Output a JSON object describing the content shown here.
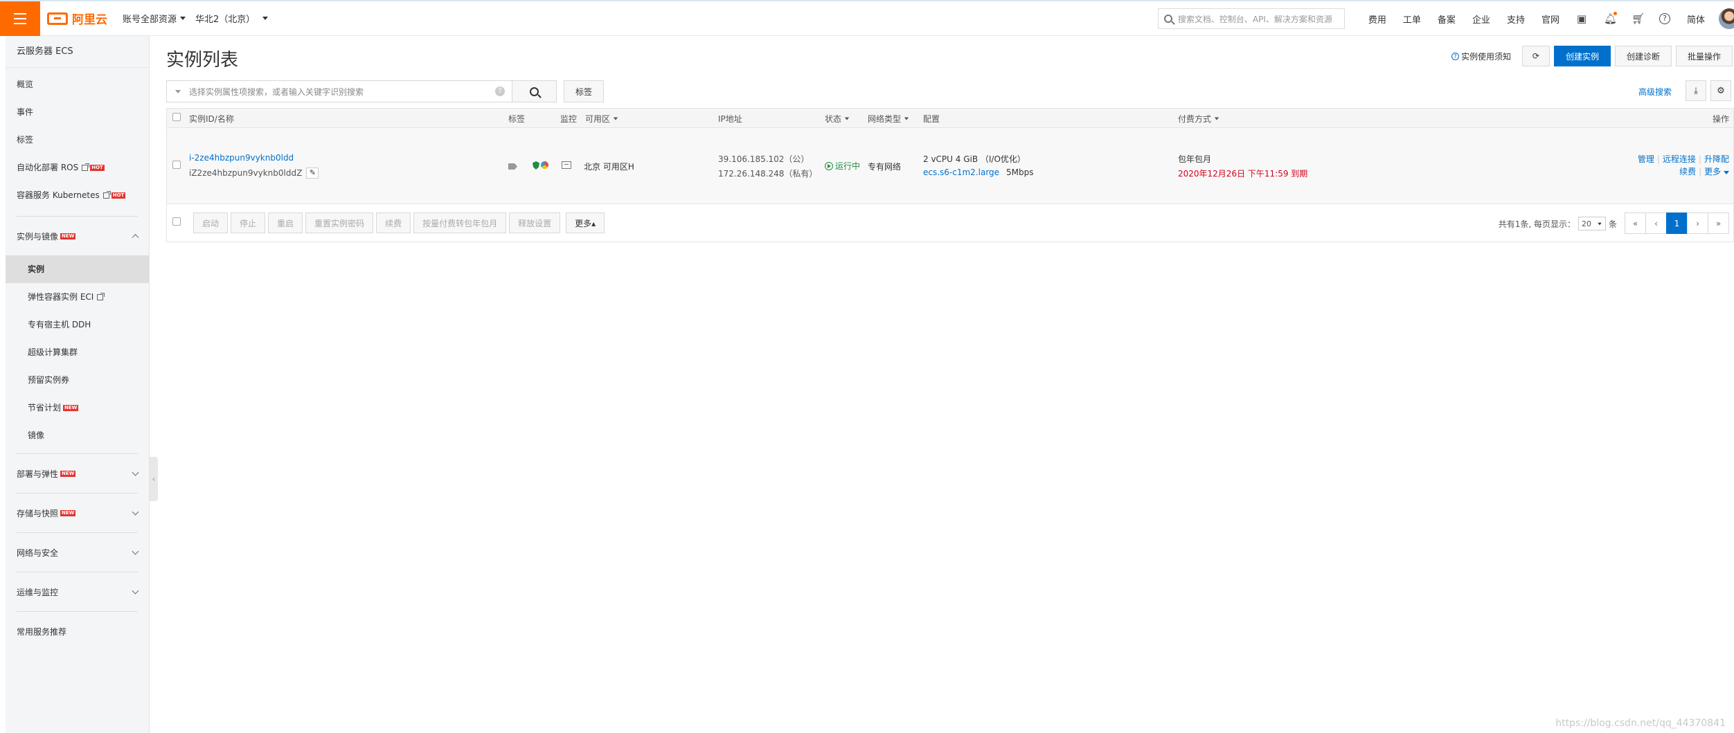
{
  "topbar": {
    "logo_text": "阿里云",
    "account_dropdown": "账号全部资源",
    "region_dropdown": "华北2（北京）",
    "search_placeholder": "搜索文档、控制台、API、解决方案和资源",
    "links": [
      "费用",
      "工单",
      "备案",
      "企业",
      "支持",
      "官网"
    ],
    "language": "简体",
    "icons": [
      "terminal-icon",
      "bell-icon",
      "cart-icon",
      "help-icon"
    ]
  },
  "sidebar": {
    "title": "云服务器 ECS",
    "top_items": [
      {
        "label": "概览"
      },
      {
        "label": "事件"
      },
      {
        "label": "标签"
      },
      {
        "label": "自动化部署 ROS",
        "badge": "HOT",
        "external": true
      },
      {
        "label": "容器服务 Kubernetes",
        "badge": "HOT",
        "external": true
      }
    ],
    "section_instances": {
      "label": "实例与镜像",
      "badge": "NEW"
    },
    "instance_items": [
      {
        "label": "实例",
        "active": true
      },
      {
        "label": "弹性容器实例 ECI",
        "external": true
      },
      {
        "label": "专有宿主机 DDH"
      },
      {
        "label": "超级计算集群"
      },
      {
        "label": "预留实例券"
      },
      {
        "label": "节省计划",
        "badge": "NEW"
      },
      {
        "label": "镜像"
      }
    ],
    "sections": [
      {
        "label": "部署与弹性",
        "badge": "NEW"
      },
      {
        "label": "存储与快照",
        "badge": "NEW"
      },
      {
        "label": "网络与安全"
      },
      {
        "label": "运维与监控"
      }
    ],
    "footer_item": "常用服务推荐"
  },
  "header": {
    "title": "实例列表",
    "notice_link": "实例使用须知",
    "create_instance": "创建实例",
    "create_diagnosis": "创建诊断",
    "batch_ops": "批量操作"
  },
  "search": {
    "placeholder": "选择实例属性项搜索，或者输入关键字识别搜索",
    "tag_button": "标签",
    "advanced_search": "高级搜索"
  },
  "table": {
    "headers": {
      "id_name": "实例ID/名称",
      "tags": "标签",
      "monitor": "监控",
      "zone": "可用区",
      "ip": "IP地址",
      "status": "状态",
      "network": "网络类型",
      "config": "配置",
      "billing": "付费方式",
      "actions": "操作"
    },
    "rows": [
      {
        "instance_id": "i-2ze4hbzpun9vyknb0ldd",
        "instance_name": "iZ2ze4hbzpun9vyknb0lddZ",
        "zone": "北京 可用区H",
        "public_ip": "39.106.185.102（公）",
        "private_ip": "172.26.148.248（私有）",
        "status": "运行中",
        "network": "专有网络",
        "config_line1": "2 vCPU 4 GiB （I/O优化）",
        "instance_type": "ecs.s6-c1m2.large",
        "bandwidth": "5Mbps",
        "billing_type": "包年包月",
        "expire": "2020年12月26日 下午11:59 到期",
        "actions": {
          "manage": "管理",
          "remote": "远程连接",
          "upgrade": "升降配",
          "renew": "续费",
          "more": "更多"
        }
      }
    ]
  },
  "footer": {
    "buttons": [
      "启动",
      "停止",
      "重启",
      "重置实例密码",
      "续费",
      "按量付费转包年包月",
      "释放设置"
    ],
    "more": "更多▴",
    "total_text": "共有1条, 每页显示：",
    "page_size": "20",
    "page_size_unit": "条",
    "pages": [
      "«",
      "‹",
      "1",
      "›",
      "»"
    ],
    "current_page": "1"
  },
  "watermark": "https://blog.csdn.net/qq_44370841",
  "colors": {
    "brand_orange": "#ff6a00",
    "primary_blue": "#0070cc",
    "running_green": "#1e8e3e",
    "expire_red": "#d0021b"
  }
}
